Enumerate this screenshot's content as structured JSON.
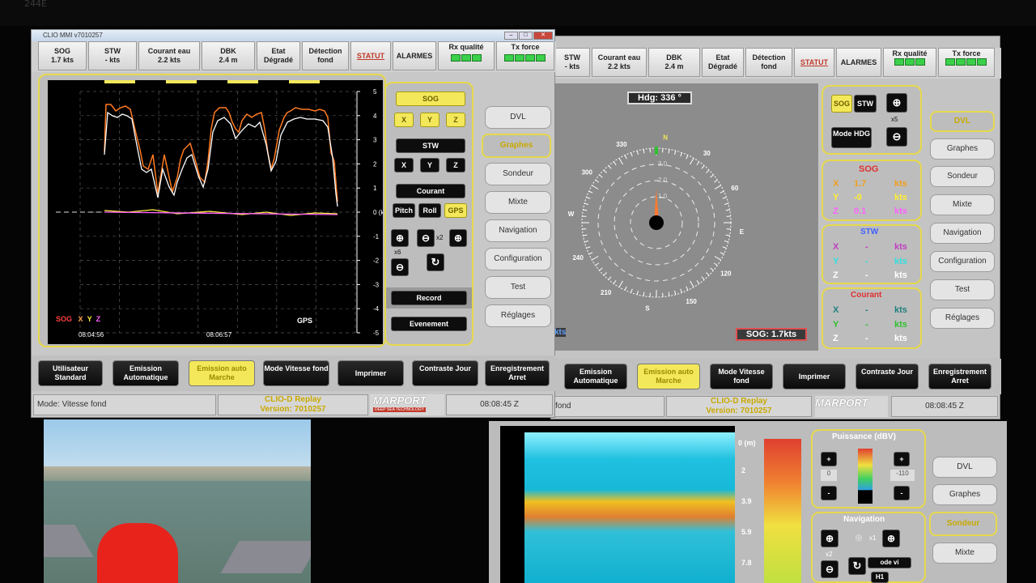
{
  "bezel_label": "244E",
  "left_window": {
    "title": "CLIO MMI v7010257",
    "status": [
      {
        "label": "SOG",
        "value": "1.7 kts"
      },
      {
        "label": "STW",
        "value": "- kts"
      },
      {
        "label": "Courant eau",
        "value": "2.2 kts"
      },
      {
        "label": "DBK",
        "value": "2.4 m"
      },
      {
        "label": "Etat",
        "value": "Dégradé"
      },
      {
        "label": "Détection",
        "value": "fond"
      },
      {
        "label": "STATUT",
        "value": ""
      },
      {
        "label": "ALARMES",
        "value": ""
      },
      {
        "label": "Rx qualité",
        "value": ""
      },
      {
        "label": "Tx force",
        "value": ""
      }
    ],
    "chart_times": [
      "08:04:56",
      "08:06:57"
    ],
    "y_ticks": [
      "5",
      "4",
      "3",
      "2",
      "1",
      "0 (kts)",
      "-1",
      "-2",
      "-3",
      "-4",
      "-5"
    ],
    "legend": [
      "SOG",
      "X",
      "Y",
      "Z"
    ],
    "gps": "GPS",
    "controls": {
      "sog": "SOG",
      "x": "X",
      "y": "Y",
      "z": "Z",
      "stw": "STW",
      "courant": "Courant",
      "pitch": "Pitch",
      "roll": "Roll",
      "gps": "GPS",
      "zoom_x6": "x6",
      "zoom_x2": "x2",
      "record": "Record",
      "evenement": "Evenement"
    },
    "tabs": [
      "DVL",
      "Graphes",
      "Sondeur",
      "Mixte",
      "Navigation",
      "Configuration",
      "Test",
      "Réglages"
    ],
    "bottom_buttons": [
      "Utilisateur Standard",
      "Emission Automatique",
      "Emission auto Marche",
      "Mode Vitesse fond",
      "Imprimer",
      "Contraste Jour",
      "Enregistrement Arret"
    ],
    "footer_mode": "Mode: Vitesse fond",
    "footer_replay": "CLIO-D Replay",
    "footer_version": "Version: 7010257",
    "footer_time": "08:08:45 Z",
    "logo": "MARPORT",
    "logo_tag": "DEEP SEA TECHNOLOGY"
  },
  "right_window": {
    "status": [
      "STW - kts",
      "Courant eau 2.2 kts",
      "DBK 2.4 m",
      "Etat Dégradé",
      "Détection fond",
      "STATUT",
      "ALARMES",
      "Rx qualité",
      "Tx force"
    ],
    "heading": "Hdg: 336 °",
    "sog_label": "SOG: 1.7kts",
    "compass_ticks": [
      "330",
      "N",
      "30",
      "60",
      "E",
      "120",
      "150",
      "S",
      "210",
      "240",
      "W",
      "300"
    ],
    "rings": [
      "3.0",
      "2.0",
      "1.0"
    ],
    "btn_sog": "SOG",
    "btn_stw": "STW",
    "mode_hdg": "Mode HDG",
    "zoom": "x5",
    "sog_box": {
      "title": "SOG",
      "rows": [
        [
          "X",
          "1.7",
          "kts"
        ],
        [
          "Y",
          "-0",
          "kts"
        ],
        [
          "Z",
          "0.1",
          "kts"
        ]
      ]
    },
    "stw_box": {
      "title": "STW",
      "rows": [
        [
          "X",
          "-",
          "kts"
        ],
        [
          "Y",
          "-",
          "kts"
        ],
        [
          "Z",
          "-",
          "kts"
        ]
      ]
    },
    "cur_box": {
      "title": "Courant",
      "rows": [
        [
          "X",
          "-",
          "kts"
        ],
        [
          "Y",
          "-",
          "kts"
        ],
        [
          "Z",
          "-",
          "kts"
        ]
      ]
    },
    "tabs": [
      "DVL",
      "Graphes",
      "Sondeur",
      "Mixte",
      "Navigation",
      "Configuration",
      "Test",
      "Réglages"
    ],
    "bottom_buttons": [
      "Emission Automatique",
      "Emission auto Marche",
      "Mode Vitesse fond",
      "Imprimer",
      "Contraste Jour",
      "Enregistrement Arret"
    ],
    "footer_mode": "fond",
    "footer_replay": "CLIO-D Replay",
    "footer_version": "Version: 7010257",
    "footer_time": "08:08:45 Z",
    "edge_label": "kts"
  },
  "sonar_window": {
    "depth_ticks": [
      "0 (m)",
      "2",
      "3.9",
      "5.9",
      "7.8"
    ],
    "puissance": "Puissance (dBV)",
    "p_value": "0",
    "p_value2": "-110",
    "navigation": "Navigation",
    "zoom_x1": "x1",
    "zoom_x2": "x2",
    "mode_text": "ode vi",
    "h1": "H1",
    "tabs": [
      "DVL",
      "Graphes",
      "Sondeur",
      "Mixte"
    ]
  }
}
